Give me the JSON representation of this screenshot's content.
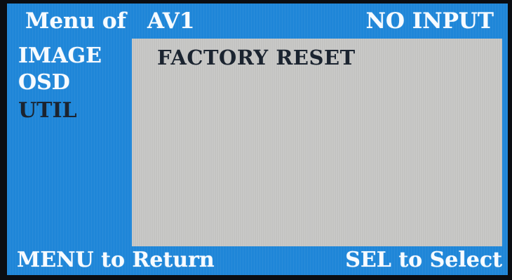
{
  "header": {
    "menu_label": "Menu of",
    "source": "AV1",
    "status": "NO INPUT"
  },
  "sidebar": {
    "items": [
      {
        "label": "IMAGE",
        "selected": false
      },
      {
        "label": "OSD",
        "selected": false
      },
      {
        "label": "UTIL",
        "selected": true
      }
    ]
  },
  "panel": {
    "options": [
      "FACTORY RESET"
    ]
  },
  "footer": {
    "left": "MENU to Return",
    "right": "SEL to Select"
  },
  "colors": {
    "osd_background": "#1f86d8",
    "panel_background": "#c3c3c1",
    "text_white": "#f7fbff",
    "text_selected": "#1b2430"
  }
}
